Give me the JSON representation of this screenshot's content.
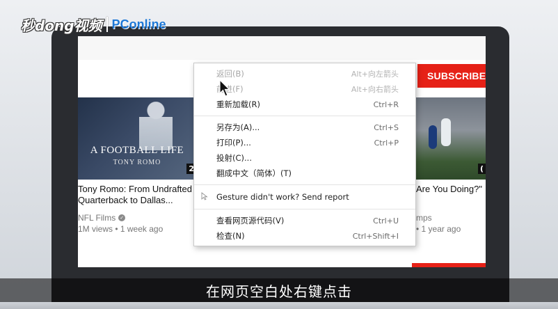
{
  "colors": {
    "subscribe_red": "#e62117",
    "menu_bg": "#ffffff",
    "brand_blue": "#1e78d6"
  },
  "brand": {
    "logo_text": "秒dong视频",
    "partner": "PConline"
  },
  "youtube": {
    "subscribe_label": "SUBSCRIBE 2",
    "videos": [
      {
        "thumb_title": "A FOOTBALL LIFE",
        "thumb_subtitle": "TONY ROMO",
        "duration": "2",
        "title": "Tony Romo: From Undrafted\nQuarterback to Dallas...",
        "channel": "NFL Films",
        "meta": "1M views • 1 week ago"
      },
      {
        "duration": "",
        "title": "Are You Doing?\"",
        "channel": "mps",
        "meta": "• 1 year ago"
      }
    ]
  },
  "context_menu": {
    "group1": [
      {
        "label": "返回(B)",
        "shortcut": "Alt+向左箭头",
        "disabled": true
      },
      {
        "label": "前进(F)",
        "shortcut": "Alt+向右箭头",
        "disabled": true
      },
      {
        "label": "重新加载(R)",
        "shortcut": "Ctrl+R",
        "disabled": false
      }
    ],
    "group2": [
      {
        "label": "另存为(A)...",
        "shortcut": "Ctrl+S"
      },
      {
        "label": "打印(P)...",
        "shortcut": "Ctrl+P"
      },
      {
        "label": "投射(C)...",
        "shortcut": ""
      },
      {
        "label": "翻成中文（简体）(T)",
        "shortcut": ""
      }
    ],
    "gesture": {
      "label": "Gesture didn't work? Send report",
      "icon": "cursor-icon"
    },
    "group3": [
      {
        "label": "查看网页源代码(V)",
        "shortcut": "Ctrl+U"
      },
      {
        "label": "检查(N)",
        "shortcut": "Ctrl+Shift+I"
      }
    ]
  },
  "caption": "在网页空白处右键点击"
}
